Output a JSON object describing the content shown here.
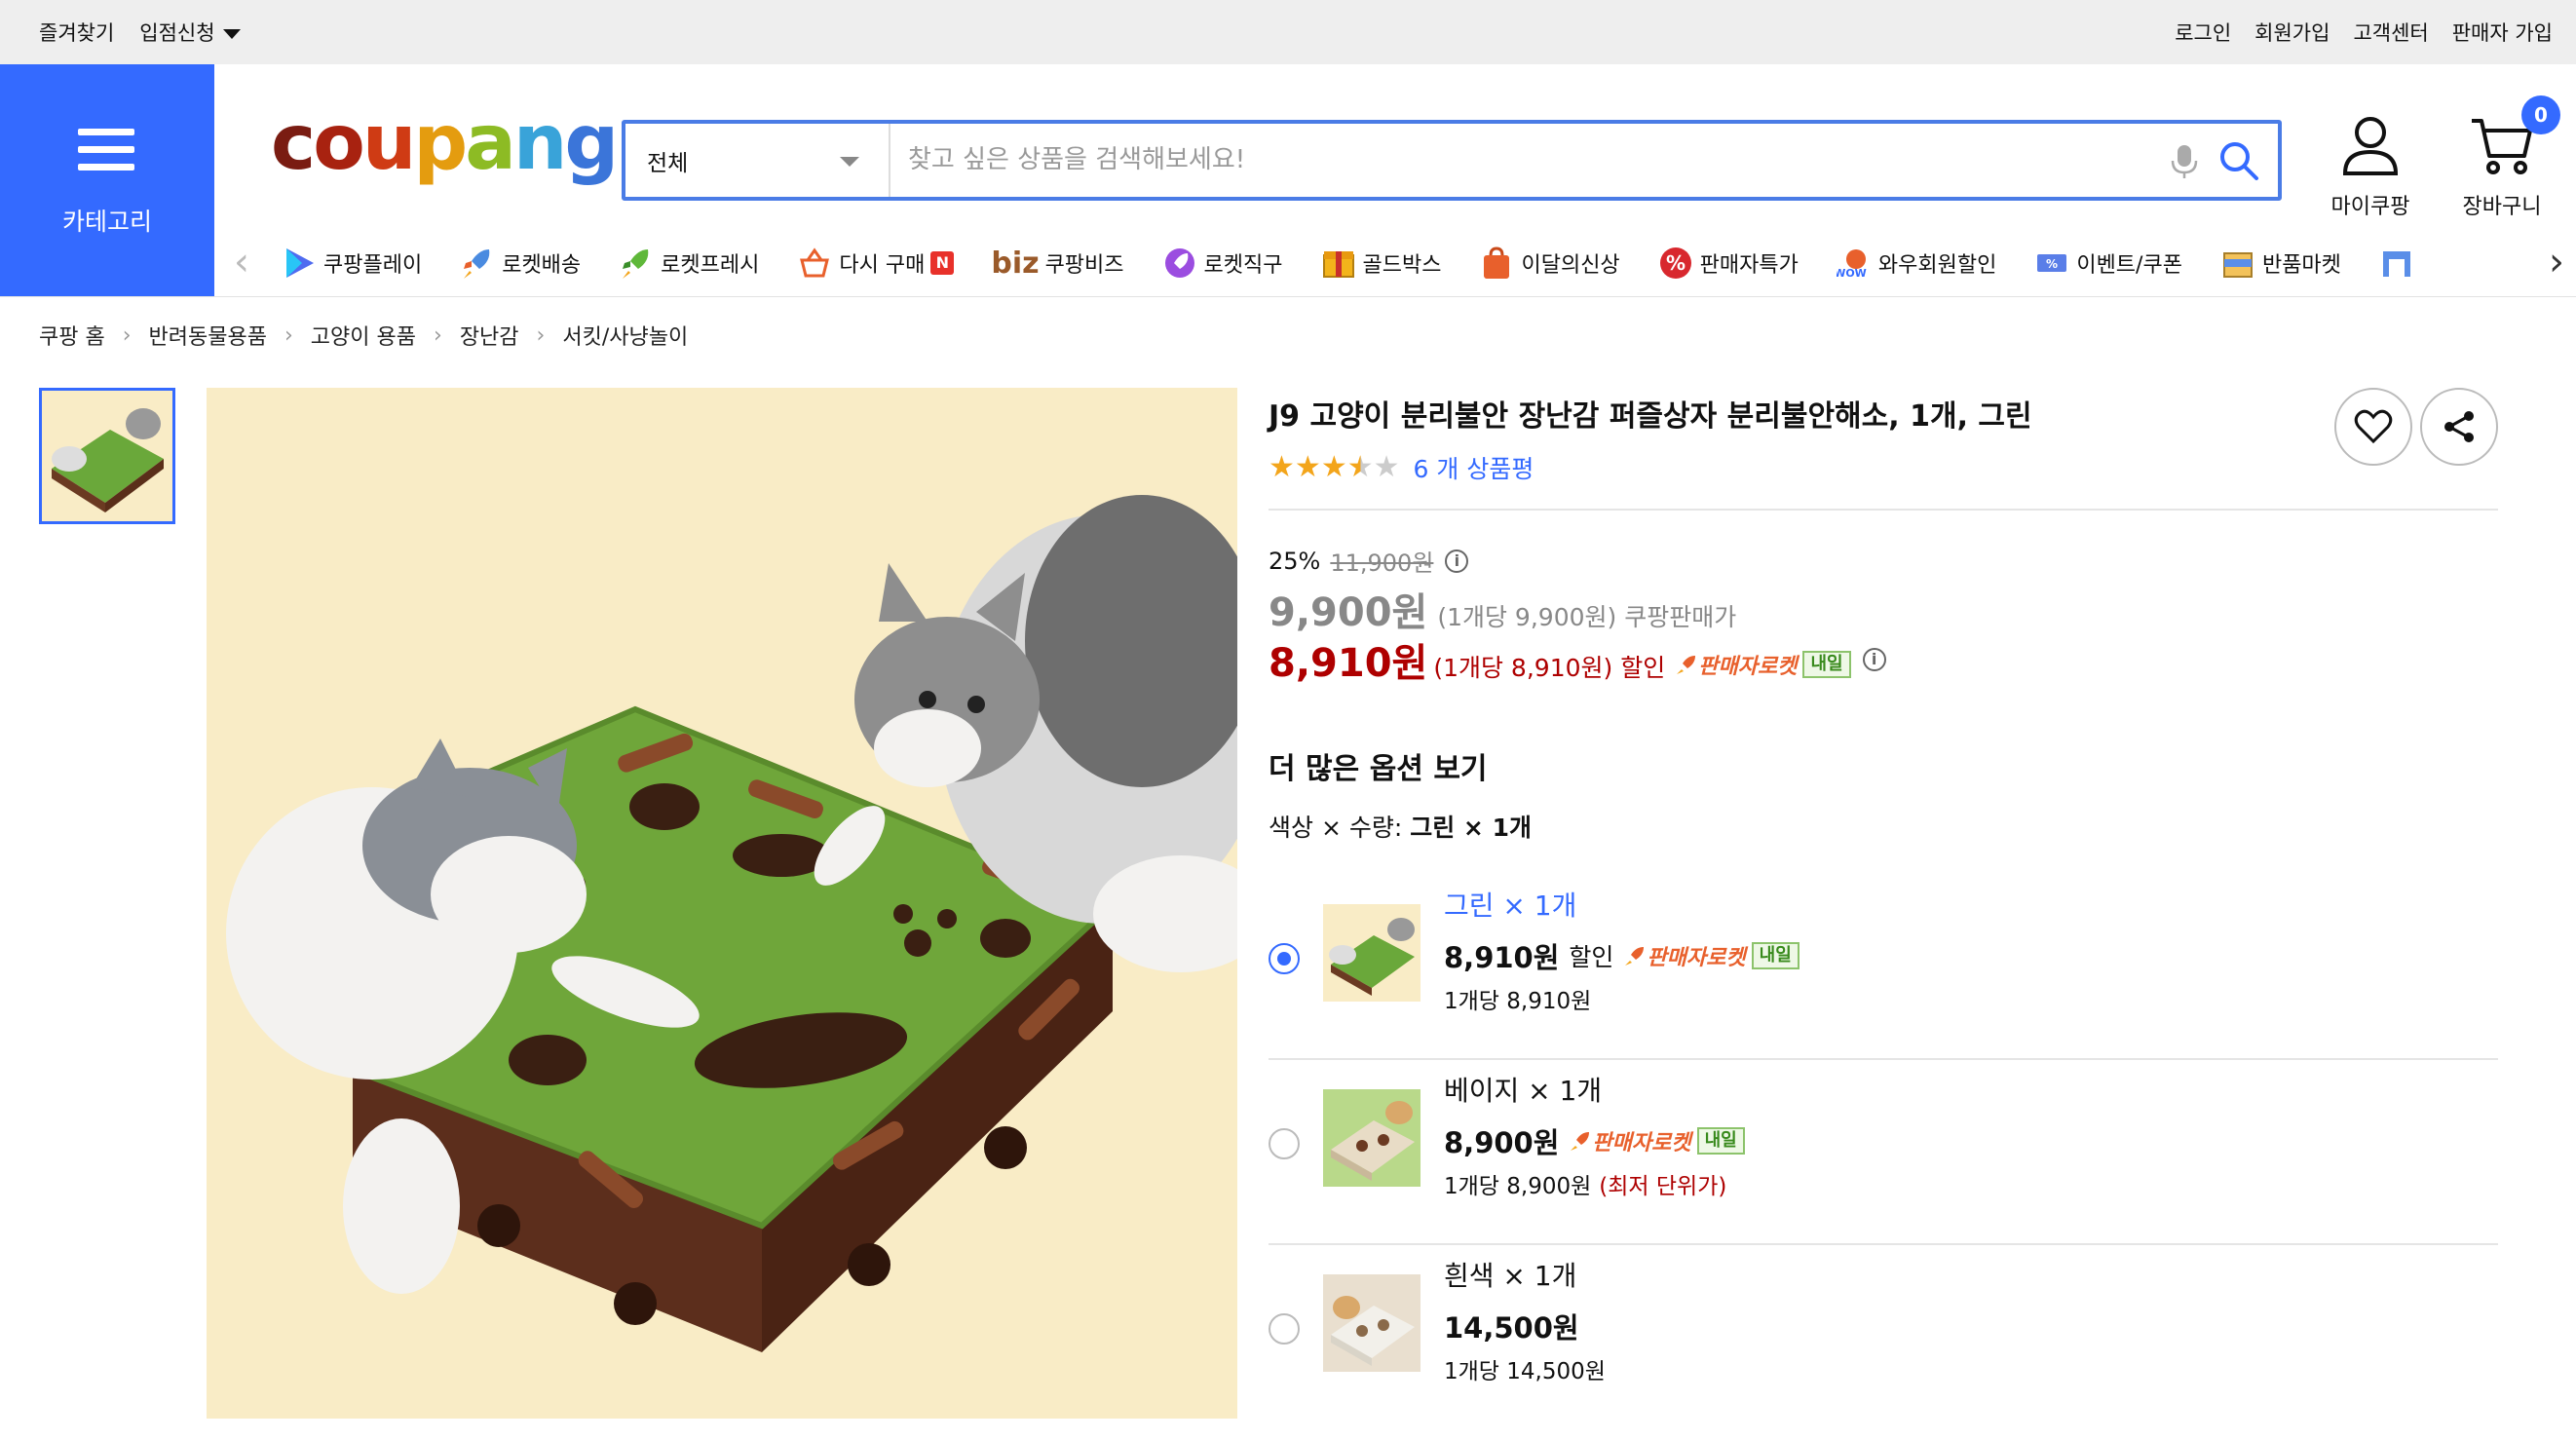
{
  "topbar": {
    "left": [
      "즐겨찾기",
      "입점신청"
    ],
    "right": [
      "로그인",
      "회원가입",
      "고객센터",
      "판매자 가입"
    ]
  },
  "header": {
    "category_label": "카테고리",
    "logo_text": [
      "c",
      "o",
      "u",
      "p",
      "a",
      "n",
      "g"
    ],
    "search": {
      "category": "전체",
      "placeholder": "찾고 싶은 상품을 검색해보세요!"
    },
    "mycoupang_label": "마이쿠팡",
    "cart_label": "장바구니",
    "cart_count": "0"
  },
  "nav": {
    "items": [
      {
        "label": "쿠팡플레이",
        "icon": "play-icon"
      },
      {
        "label": "로켓배송",
        "icon": "rocket-icon"
      },
      {
        "label": "로켓프레시",
        "icon": "rocket-fresh-icon"
      },
      {
        "label": "다시 구매",
        "icon": "basket-icon",
        "badge": "N"
      },
      {
        "label": "쿠팡비즈",
        "icon": "biz-icon",
        "prefix": "biz"
      },
      {
        "label": "로켓직구",
        "icon": "global-rocket-icon"
      },
      {
        "label": "골드박스",
        "icon": "goldbox-icon"
      },
      {
        "label": "이달의신상",
        "icon": "new-bag-icon"
      },
      {
        "label": "판매자특가",
        "icon": "percent-icon"
      },
      {
        "label": "와우회원할인",
        "icon": "wow-icon"
      },
      {
        "label": "이벤트/쿠폰",
        "icon": "coupon-icon"
      },
      {
        "label": "반품마켓",
        "icon": "sale-box-icon"
      }
    ]
  },
  "breadcrumb": [
    "쿠팡 홈",
    "반려동물용품",
    "고양이 용품",
    "장난감",
    "서킷/사냥놀이"
  ],
  "product": {
    "title": "J9 고양이 분리불안 장난감 퍼즐상자 분리불안해소, 1개, 그린",
    "rating": 3.5,
    "review_text": "6 개 상품평",
    "discount_rate": "25%",
    "original_price": "11,900원",
    "coupang_price": "9,900원",
    "coupang_unit": "(1개당 9,900원)",
    "coupang_price_label": "쿠팡판매가",
    "sale_price": "8,910원",
    "sale_unit": "(1개당 8,910원)",
    "sale_label": "할인",
    "rocket_label": "판매자로켓",
    "tomorrow_label": "내일"
  },
  "options": {
    "heading": "더 많은 옵션 보기",
    "selected_label": "색상 × 수량:",
    "selected_value": "그린 × 1개",
    "items": [
      {
        "name": "그린 × 1개",
        "price": "8,910원",
        "discount": "할인",
        "rocket": "판매자로켓",
        "tomorrow": "내일",
        "unit": "1개당 8,910원",
        "selected": true,
        "color": "#6aa83a"
      },
      {
        "name": "베이지 × 1개",
        "price": "8,900원",
        "discount": "",
        "rocket": "판매자로켓",
        "tomorrow": "내일",
        "unit": "1개당 8,900원",
        "note": "(최저 단위가)",
        "selected": false,
        "color": "#e8dcc6"
      },
      {
        "name": "흰색 × 1개",
        "price": "14,500원",
        "discount": "",
        "rocket": "",
        "tomorrow": "",
        "unit": "1개당 14,500원",
        "selected": false,
        "color": "#f2f0ea"
      }
    ]
  }
}
